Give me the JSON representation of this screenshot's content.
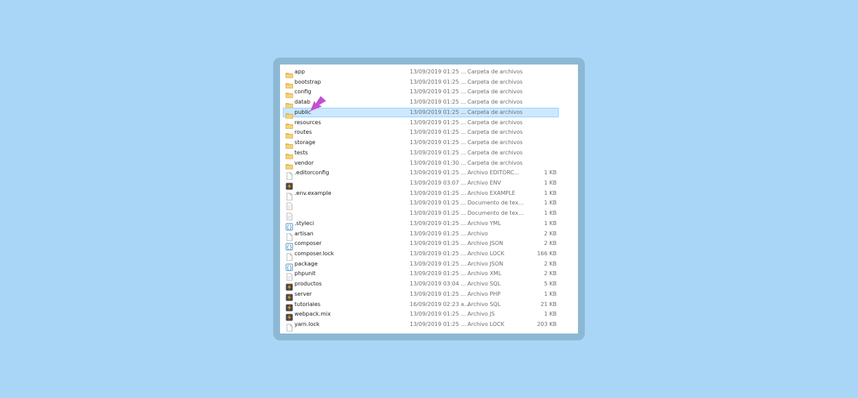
{
  "colors": {
    "page_background": "#a9d5f7",
    "frame": "#8db8d4",
    "selection": "#cce8ff",
    "arrow": "#c44fd1"
  },
  "files": [
    {
      "name": "app",
      "date": "13/09/2019 01:25 ...",
      "type": "Carpeta de archivos",
      "size": "",
      "icon": "folder-icon"
    },
    {
      "name": "bootstrap",
      "date": "13/09/2019 01:25 ...",
      "type": "Carpeta de archivos",
      "size": "",
      "icon": "folder-icon"
    },
    {
      "name": "config",
      "date": "13/09/2019 01:25 ...",
      "type": "Carpeta de archivos",
      "size": "",
      "icon": "folder-icon"
    },
    {
      "name": "datab",
      "date": "13/09/2019 01:25 ...",
      "type": "Carpeta de archivos",
      "size": "",
      "icon": "folder-icon"
    },
    {
      "name": "public",
      "date": "13/09/2019 01:25 ...",
      "type": "Carpeta de archivos",
      "size": "",
      "icon": "folder-icon",
      "selected": true
    },
    {
      "name": "resources",
      "date": "13/09/2019 01:25 ...",
      "type": "Carpeta de archivos",
      "size": "",
      "icon": "folder-icon"
    },
    {
      "name": "routes",
      "date": "13/09/2019 01:25 ...",
      "type": "Carpeta de archivos",
      "size": "",
      "icon": "folder-icon"
    },
    {
      "name": "storage",
      "date": "13/09/2019 01:25 ...",
      "type": "Carpeta de archivos",
      "size": "",
      "icon": "folder-icon"
    },
    {
      "name": "tests",
      "date": "13/09/2019 01:25 ...",
      "type": "Carpeta de archivos",
      "size": "",
      "icon": "folder-icon"
    },
    {
      "name": "vendor",
      "date": "13/09/2019 01:30 ...",
      "type": "Carpeta de archivos",
      "size": "",
      "icon": "folder-icon"
    },
    {
      "name": ".editorconfig",
      "date": "13/09/2019 01:25 ...",
      "type": "Archivo EDITORC...",
      "size": "1 KB",
      "icon": "file-icon"
    },
    {
      "name": "",
      "date": "13/09/2019 03:07 ...",
      "type": "Archivo ENV",
      "size": "1 KB",
      "icon": "sublime-icon"
    },
    {
      "name": ".env.example",
      "date": "13/09/2019 01:25 ...",
      "type": "Archivo EXAMPLE",
      "size": "1 KB",
      "icon": "file-icon"
    },
    {
      "name": "",
      "date": "13/09/2019 01:25 ...",
      "type": "Documento de tex...",
      "size": "1 KB",
      "icon": "text-file-icon"
    },
    {
      "name": "",
      "date": "13/09/2019 01:25 ...",
      "type": "Documento de tex...",
      "size": "1 KB",
      "icon": "text-file-icon"
    },
    {
      "name": ".styleci",
      "date": "13/09/2019 01:25 ...",
      "type": "Archivo YML",
      "size": "1 KB",
      "icon": "braces-icon"
    },
    {
      "name": "artisan",
      "date": "13/09/2019 01:25 ...",
      "type": "Archivo",
      "size": "2 KB",
      "icon": "file-icon"
    },
    {
      "name": "composer",
      "date": "13/09/2019 01:25 ...",
      "type": "Archivo JSON",
      "size": "2 KB",
      "icon": "braces-icon"
    },
    {
      "name": "composer.lock",
      "date": "13/09/2019 01:25 ...",
      "type": "Archivo LOCK",
      "size": "166 KB",
      "icon": "file-icon"
    },
    {
      "name": "package",
      "date": "13/09/2019 01:25 ...",
      "type": "Archivo JSON",
      "size": "2 KB",
      "icon": "braces-icon"
    },
    {
      "name": "phpunit",
      "date": "13/09/2019 01:25 ...",
      "type": "Archivo XML",
      "size": "2 KB",
      "icon": "text-file-icon"
    },
    {
      "name": "productos",
      "date": "13/09/2019 03:04 ...",
      "type": "Archivo SQL",
      "size": "5 KB",
      "icon": "sublime-icon"
    },
    {
      "name": "server",
      "date": "13/09/2019 01:25 ...",
      "type": "Archivo PHP",
      "size": "1 KB",
      "icon": "sublime-icon"
    },
    {
      "name": "tutoriales",
      "date": "16/09/2019 02:23 a...",
      "type": "Archivo SQL",
      "size": "21 KB",
      "icon": "sublime-icon"
    },
    {
      "name": "webpack.mix",
      "date": "13/09/2019 01:25 ...",
      "type": "Archivo JS",
      "size": "1 KB",
      "icon": "sublime-icon"
    },
    {
      "name": "yarn.lock",
      "date": "13/09/2019 01:25 ...",
      "type": "Archivo LOCK",
      "size": "203 KB",
      "icon": "file-icon"
    }
  ]
}
